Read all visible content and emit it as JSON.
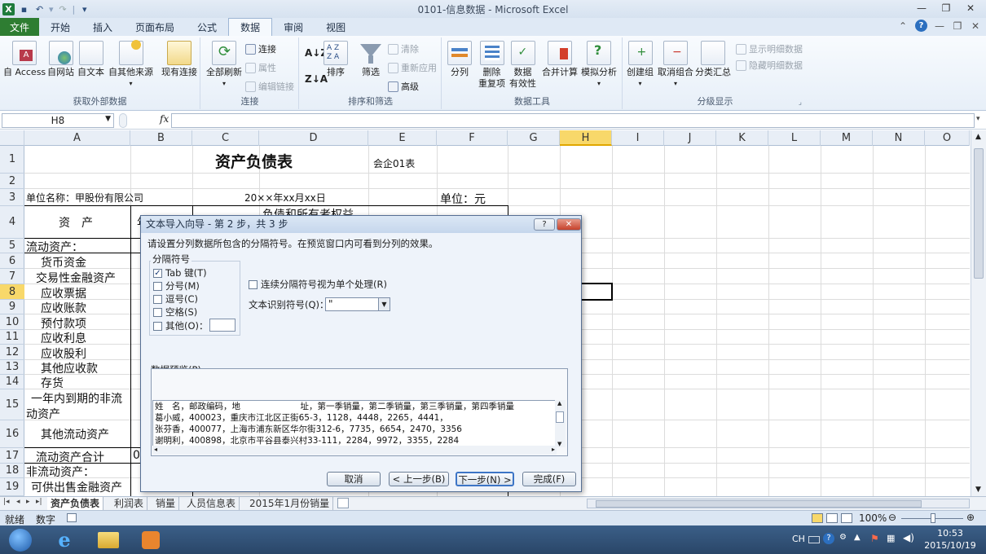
{
  "window": {
    "title": "0101-信息数据 - Microsoft Excel"
  },
  "tabs": [
    "文件",
    "开始",
    "插入",
    "页面布局",
    "公式",
    "数据",
    "审阅",
    "视图"
  ],
  "active_tab": "数据",
  "ribbon": {
    "groups": {
      "external": "获取外部数据",
      "connect": "连接",
      "sortfilter": "排序和筛选",
      "datatools": "数据工具",
      "outline": "分级显示"
    },
    "buttons": {
      "access": "自 Access",
      "web": "自网站",
      "text": "自文本",
      "other": "自其他来源",
      "existing": "现有连接",
      "refresh": "全部刷新",
      "conn": "连接",
      "props": "属性",
      "editlinks": "编辑链接",
      "sort_az": "A↓Z",
      "sort": "排序",
      "filter": "筛选",
      "clear": "清除",
      "reapply": "重新应用",
      "advanced": "高级",
      "split": "分列",
      "dedup1": "删除",
      "dedup2": "重复项",
      "valid1": "数据",
      "valid2": "有效性",
      "consolidate": "合并计算",
      "whatif": "模拟分析",
      "group": "创建组",
      "ungroup": "取消组合",
      "subtotal": "分类汇总",
      "showdetail": "显示明细数据",
      "hidedetail": "隐藏明细数据"
    }
  },
  "formula_bar": {
    "name_box": "H8",
    "fx": "fx",
    "formula": ""
  },
  "columns": [
    "A",
    "B",
    "C",
    "D",
    "E",
    "F",
    "G",
    "H",
    "I",
    "J",
    "K",
    "L",
    "M",
    "N",
    "O"
  ],
  "selected_column": "H",
  "rows": [
    "1",
    "2",
    "3",
    "4",
    "5",
    "6",
    "7",
    "8",
    "9",
    "10",
    "11",
    "12",
    "13",
    "14",
    "15",
    "16",
    "17",
    "18",
    "19"
  ],
  "selected_row": "8",
  "cells": {
    "title": "资产负债表",
    "form_no": "会企01表",
    "company": "单位名称：甲股份有限公司",
    "date": "20××年xx月xx日",
    "unit": "单位：元",
    "asset_hdr": "资　产",
    "b4_partial": "年",
    "liab_hdr": "负债和所有者权益",
    "a5": "流动资产：",
    "a6": "货币资金",
    "a7": "交易性金融资产",
    "a8": "应收票据",
    "a9": "应收账款",
    "a10": "预付款项",
    "a11": "应收利息",
    "a12": "应收股利",
    "a13": "其他应收款",
    "a14": "存货",
    "a15a": "一年内到期的非流",
    "a15b": "动资产",
    "a16": "其他流动资产",
    "a17": "流动资产合计",
    "b17": "0",
    "a18": "非流动资产：",
    "a19": "可供出售金融资产"
  },
  "sheets": [
    "资产负债表",
    "利润表",
    "销量",
    "人员信息表",
    "2015年1月份销量"
  ],
  "active_sheet": "资产负债表",
  "status": {
    "ready": "就绪",
    "numlock": "数字",
    "zoom": "100%"
  },
  "taskbar": {
    "lang": "CH",
    "time": "10:53",
    "date": "2015/10/19"
  },
  "dialog": {
    "title": "文本导入向导 - 第 2 步，共 3 步",
    "help_btn": "?",
    "instruction": "请设置分列数据所包含的分隔符号。在预览窗口内可看到分列的效果。",
    "delim_group": "分隔符号",
    "delims": [
      {
        "label": "Tab 键(T)",
        "checked": "✓"
      },
      {
        "label": "分号(M)",
        "checked": ""
      },
      {
        "label": "逗号(C)",
        "checked": ""
      },
      {
        "label": "空格(S)",
        "checked": ""
      },
      {
        "label": "其他(O)：",
        "checked": ""
      }
    ],
    "consecutive": "连续分隔符号视为单个处理(R)",
    "qualifier_label": "文本识别符号(Q)：",
    "qualifier_value": "\"",
    "preview_label": "数据预览(P)",
    "preview_lines": [
      "姓　名，邮政编码，地　　　　　　　址，第一季销量，第二季销量，第三季销量，第四季销量",
      "葛小威，400023，重庆市江北区正街65-3，1128，4448，2265，4441，",
      "张芬香，400077，上海市浦东新区华尔街312-6，7735，6654，2470，3356",
      "谢明利，400898，北京市平谷县泰兴村33-111，2284，9972，3355，2284"
    ],
    "buttons": {
      "cancel": "取消",
      "back": "< 上一步(B)",
      "next": "下一步(N) >",
      "finish": "完成(F)"
    }
  }
}
